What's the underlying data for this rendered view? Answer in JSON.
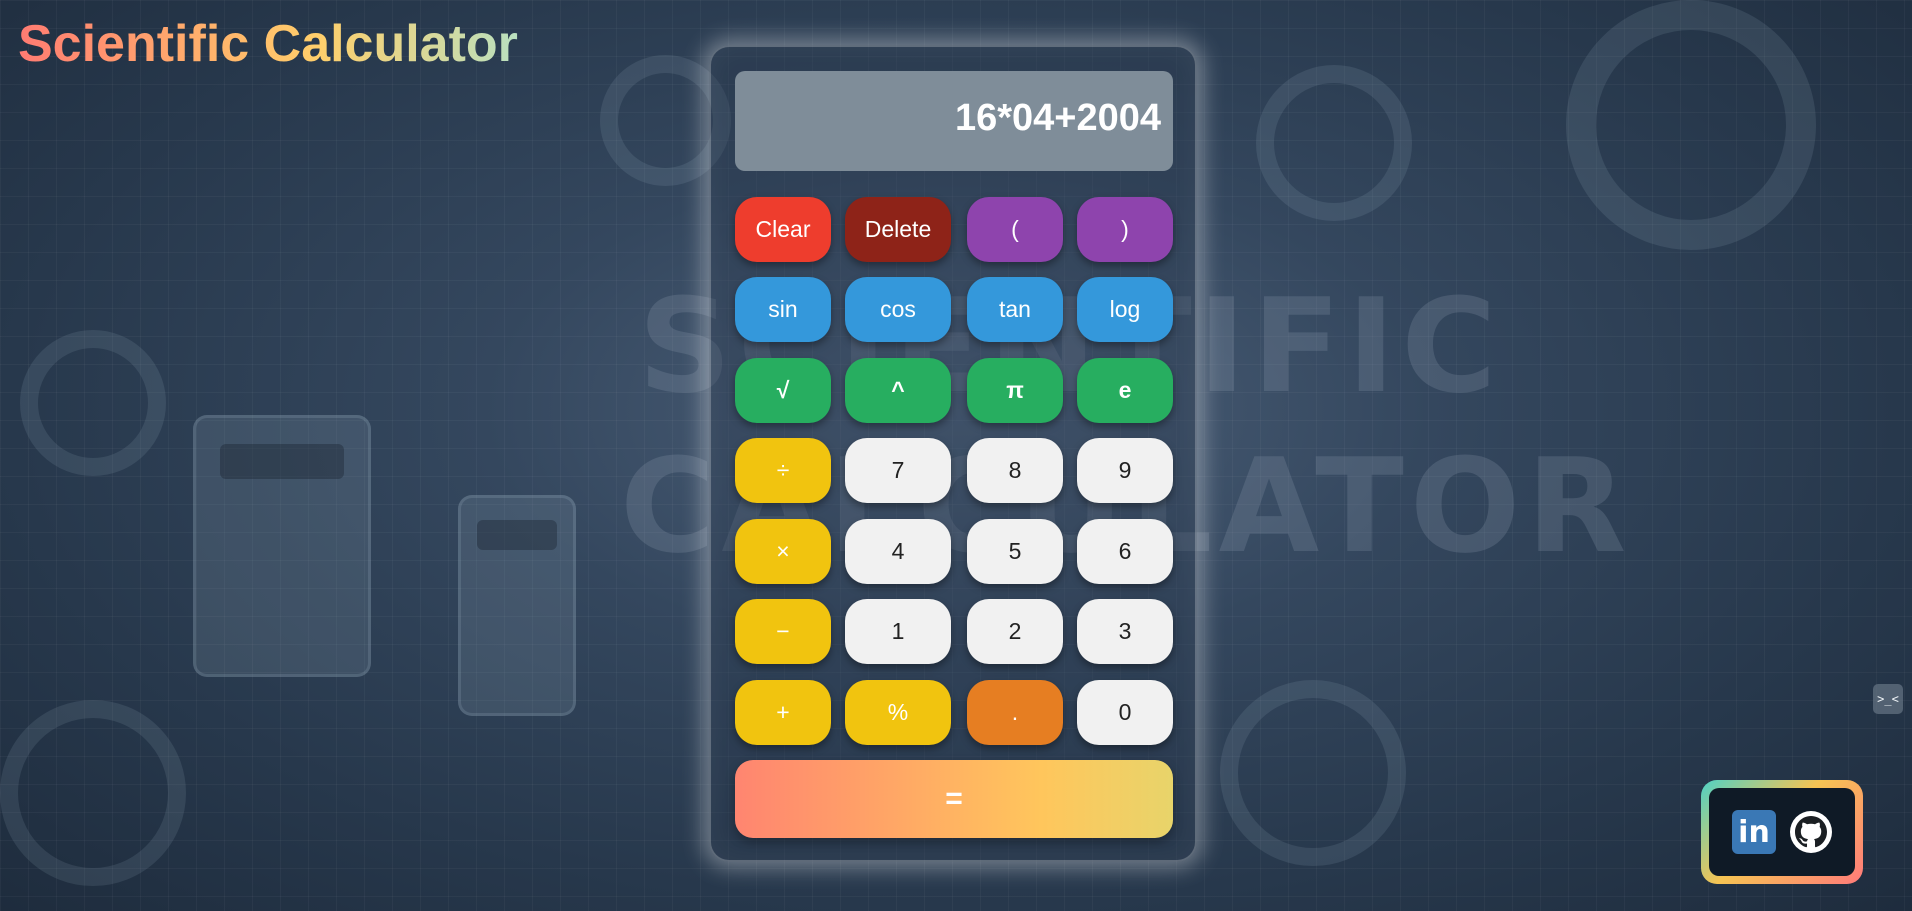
{
  "app": {
    "title_part1": "Scientific",
    "title_part2": " Calculator"
  },
  "display": {
    "value": "16*04+2004"
  },
  "buttons": {
    "row1": [
      "Clear",
      "Delete",
      "(",
      ")"
    ],
    "row2": [
      "sin",
      "cos",
      "tan",
      "log"
    ],
    "row3": [
      "√",
      "^",
      "π",
      "e"
    ],
    "row4": [
      "÷",
      "7",
      "8",
      "9"
    ],
    "row5": [
      "×",
      "4",
      "5",
      "6"
    ],
    "row6": [
      "−",
      "1",
      "2",
      "3"
    ],
    "row7": [
      "+",
      "%",
      ".",
      "0"
    ],
    "equals": "="
  },
  "social": {
    "linkedin_icon": "linkedin-icon",
    "github_icon": "github-icon",
    "linkedin_glyph": "in"
  },
  "side_widget": {
    "icon": "terminal-icon",
    "glyph": ">_<"
  },
  "colors": {
    "clear": "#ee3d2d",
    "delete": "#8e2318",
    "paren": "#8e44ad",
    "function": "#3498db",
    "math": "#27ae60",
    "operator": "#f1c40f",
    "decimal": "#e67e22",
    "digit": "#f1f1f1"
  }
}
